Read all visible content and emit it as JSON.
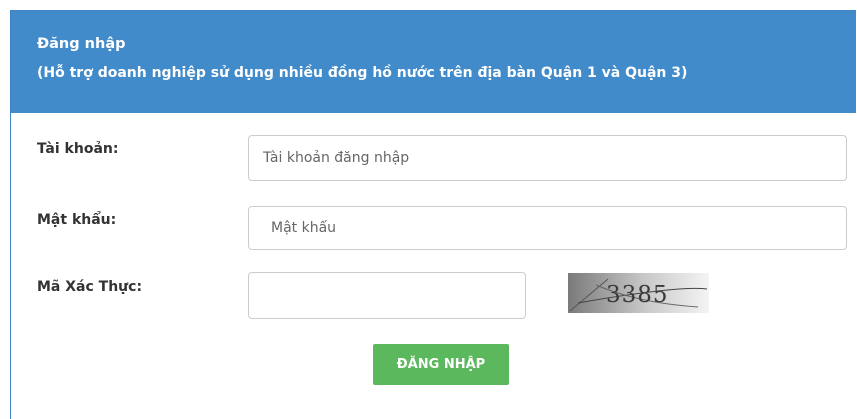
{
  "header": {
    "title": "Đăng nhập",
    "subtitle": "(Hỗ trợ doanh nghiệp sử dụng nhiều đồng hồ nước trên địa bàn Quận 1 và Quận 3)",
    "background_color": "#428bca"
  },
  "form": {
    "account_label": "Tài khoản:",
    "account_placeholder": "Tài khoản đăng nhập",
    "account_value": "",
    "password_label": "Mật khẩu:",
    "password_placeholder": "Mật khẩu",
    "password_value": "",
    "captcha_label": "Mã Xác Thực:",
    "captcha_value": "",
    "captcha_image_text": "3385",
    "login_button": "ĐĂNG NHẬP",
    "button_color": "#5cb85c"
  }
}
